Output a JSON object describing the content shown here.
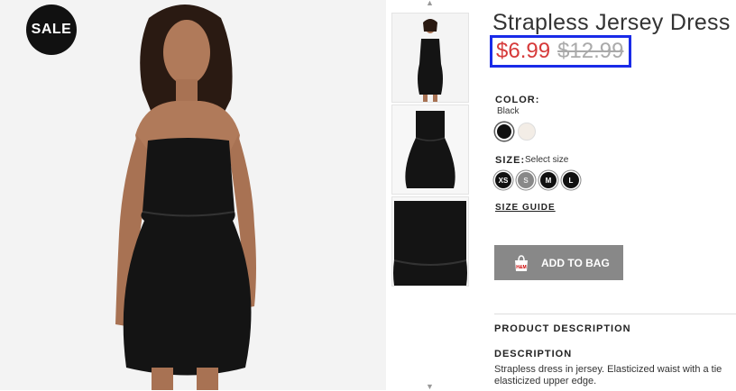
{
  "badge": {
    "sale": "SALE"
  },
  "product": {
    "title": "Strapless Jersey Dress",
    "price_sale": "$6.99",
    "price_original": "$12.99"
  },
  "color": {
    "label": "COLOR:",
    "selected": "Black",
    "swatches": [
      "#111111",
      "#f3ede6"
    ]
  },
  "size": {
    "label": "SIZE:",
    "hint": "Select size",
    "options": [
      "XS",
      "S",
      "M",
      "L"
    ]
  },
  "links": {
    "size_guide": "SIZE GUIDE"
  },
  "actions": {
    "add_to_bag": "ADD TO BAG"
  },
  "description": {
    "section_title": "PRODUCT DESCRIPTION",
    "heading": "DESCRIPTION",
    "text_line1": "Strapless dress in jersey. Elasticized waist with a tie",
    "text_line2": "elasticized upper edge."
  },
  "icons": {
    "bag": "shopping-bag-icon",
    "arrow_up": "chevron-up-icon",
    "arrow_down": "chevron-down-icon"
  }
}
